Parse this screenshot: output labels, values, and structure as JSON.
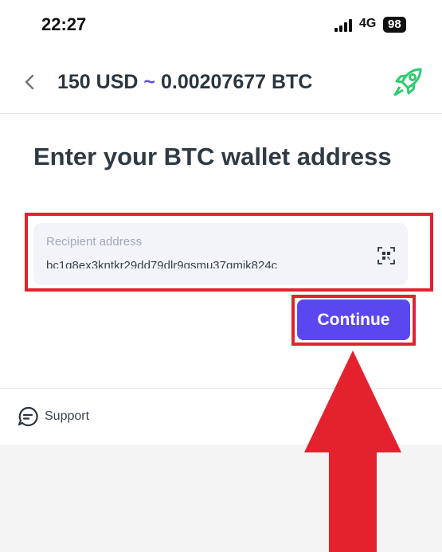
{
  "status_bar": {
    "time": "22:27",
    "network": "4G",
    "battery": "98"
  },
  "header": {
    "amount_fiat": "150 USD",
    "approx_symbol": "~",
    "amount_crypto": "0.00207677 BTC",
    "back_icon": "chevron-left-icon",
    "logo_icon": "rocket-icon"
  },
  "main": {
    "heading": "Enter your BTC wallet address",
    "recipient": {
      "placeholder": "Recipient address",
      "value": "bc1q8ex3kntkr29dd79dlr9gsmu37gmjk824c",
      "scan_icon": "qr-scan-icon"
    },
    "continue_label": "Continue"
  },
  "footer": {
    "support_label": "Support",
    "support_icon": "chat-bubble-icon"
  },
  "colors": {
    "accent": "#5b47f0",
    "highlight": "#e4222e",
    "heading": "#2f3a44",
    "logo": "#2ecc71"
  }
}
